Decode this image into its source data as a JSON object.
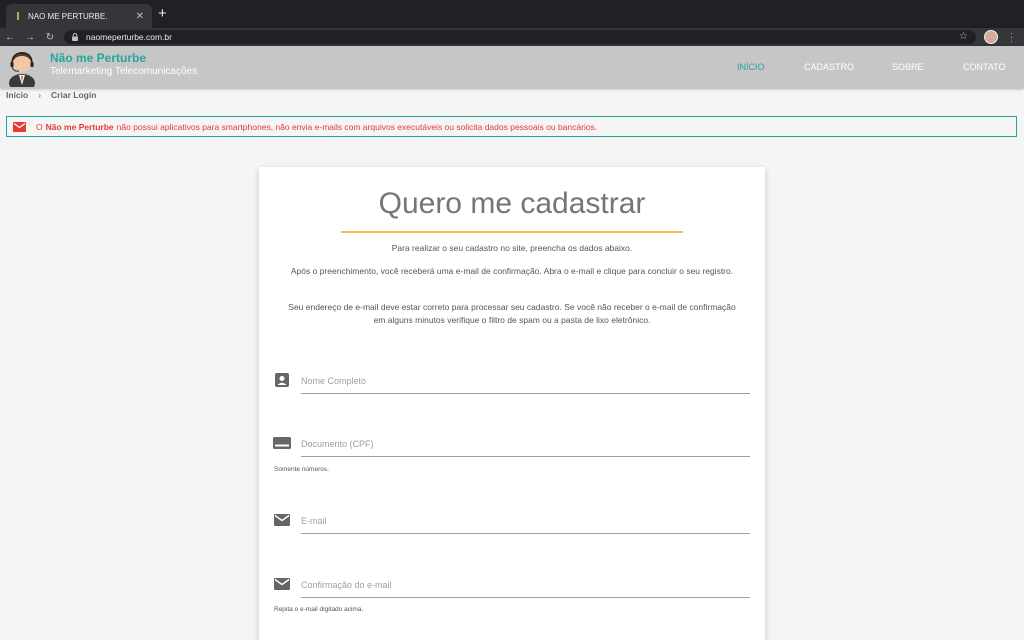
{
  "browser": {
    "tab_title": "NAO ME PERTURBE.",
    "url": "naomeperturbe.com.br"
  },
  "header": {
    "brand_name": "Não me Perturbe",
    "brand_sub": "Telemarketing Telecomunicações",
    "nav": [
      "INÍCIO",
      "CADASTRO",
      "SOBRE",
      "CONTATO"
    ],
    "accent_color": "#26a69a"
  },
  "breadcrumb": {
    "home": "Início",
    "separator": "›",
    "current": "Criar Login"
  },
  "alert": {
    "prefix": "O",
    "brand": "Não me Perturbe",
    "text": "não possui aplicativos para smartphones, não envia e-mails com arquivos executáveis ou solicita dados pessoais ou bancários."
  },
  "form": {
    "title": "Quero me cadastrar",
    "para1": "Para realizar o seu cadastro no site, preencha os dados abaixo.",
    "para2": "Após o preenchimento, você receberá uma e-mail de confirmação. Abra o e-mail e clique para concluir o seu registro.",
    "para3": "Seu endereço de e-mail deve estar correto para processar seu cadastro. Se você não receber o e-mail de confirmação em alguns minutos verifique o filtro de spam ou a pasta de lixo eletrônico.",
    "fields": [
      {
        "placeholder": "Nome Completo",
        "icon": "account-box-icon",
        "helper": ""
      },
      {
        "placeholder": "Documento (CPF)",
        "icon": "card-icon",
        "helper": "Somente números."
      },
      {
        "placeholder": "E-mail",
        "icon": "mail-icon",
        "helper": ""
      },
      {
        "placeholder": "Confirmação do e-mail",
        "icon": "mail-icon",
        "helper": "Repita o e-mail digitado acima."
      }
    ]
  }
}
